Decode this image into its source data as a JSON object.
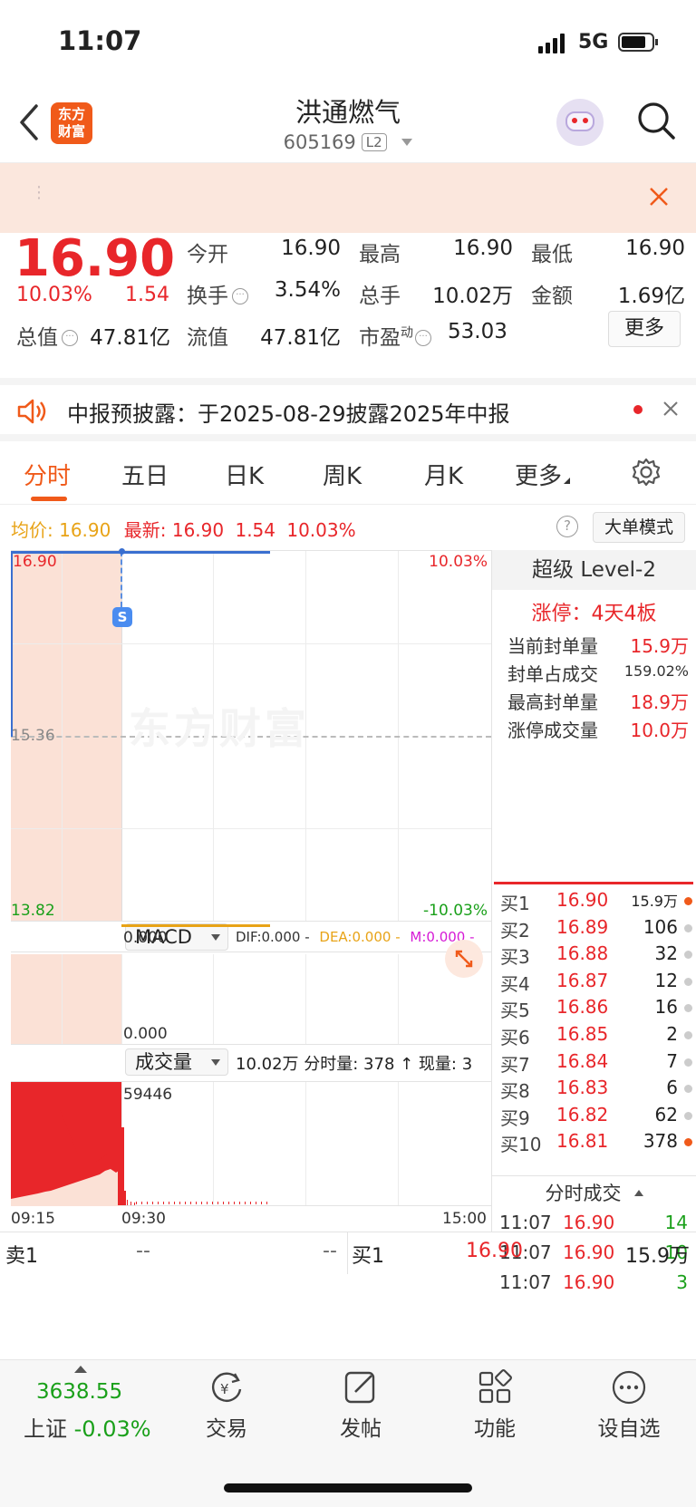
{
  "status_bar": {
    "time": "11:07",
    "network": "5G"
  },
  "header": {
    "stock_name": "洪通燃气",
    "stock_code": "605169",
    "level_badge": "L2",
    "logo_text": "东方财富"
  },
  "quote": {
    "price": "16.90",
    "change_pct": "10.03%",
    "change": "1.54",
    "open_label": "今开",
    "open": "16.90",
    "high_label": "最高",
    "high": "16.90",
    "low_label": "最低",
    "low": "16.90",
    "turnover_label": "换手",
    "turnover": "3.54%",
    "volume_label": "总手",
    "volume": "10.02万",
    "amount_label": "金额",
    "amount": "1.69亿",
    "market_cap_label": "总值",
    "market_cap": "47.81亿",
    "float_cap_label": "流值",
    "float_cap": "47.81亿",
    "pe_label": "市盈",
    "pe_super": "动",
    "pe": "53.03",
    "more_button": "更多"
  },
  "notice": {
    "text": "中报预披露：于2025-08-29披露2025年中报"
  },
  "tabs": [
    "分时",
    "五日",
    "日K",
    "周K",
    "月K",
    "更多"
  ],
  "chart_info": {
    "avg_label": "均价:",
    "avg_value": "16.90",
    "latest_label": "最新:",
    "latest_value": "16.90",
    "latest_change": "1.54",
    "latest_pct": "10.03%",
    "big_order_button": "大单模式"
  },
  "price_axis": {
    "top": "16.90",
    "mid": "15.36",
    "bottom": "13.82",
    "top_pct": "10.03%",
    "bottom_pct": "-10.03%"
  },
  "macd": {
    "selector": "MACD",
    "dif": "DIF:0.000 -",
    "dea": "DEA:0.000 -",
    "m": "M:0.000 -",
    "top_value": "0.000",
    "bottom_value": "0.000"
  },
  "volume_panel": {
    "selector": "成交量",
    "summary": "10.02万 分时量: 378 ↑ 现量: 3",
    "max_value": "59446",
    "time_start": "09:15",
    "time_mid": "09:30",
    "time_end": "15:00"
  },
  "level2": {
    "title": "超级 Level-2",
    "limit_status": "涨停：4天4板",
    "rows": [
      {
        "label": "当前封单量",
        "value": "15.9万"
      },
      {
        "label": "封单占成交",
        "value": "159.02%"
      },
      {
        "label": "最高封单量",
        "value": "18.9万"
      },
      {
        "label": "涨停成交量",
        "value": "10.0万"
      }
    ]
  },
  "order_book": [
    {
      "label": "买1",
      "price": "16.90",
      "volume": "15.9万",
      "dot": "#f05a1a"
    },
    {
      "label": "买2",
      "price": "16.89",
      "volume": "106",
      "dot": "#cccccc"
    },
    {
      "label": "买3",
      "price": "16.88",
      "volume": "32",
      "dot": "#cccccc"
    },
    {
      "label": "买4",
      "price": "16.87",
      "volume": "12",
      "dot": "#cccccc"
    },
    {
      "label": "买5",
      "price": "16.86",
      "volume": "16",
      "dot": "#cccccc"
    },
    {
      "label": "买6",
      "price": "16.85",
      "volume": "2",
      "dot": "#cccccc"
    },
    {
      "label": "买7",
      "price": "16.84",
      "volume": "7",
      "dot": "#cccccc"
    },
    {
      "label": "买8",
      "price": "16.83",
      "volume": "6",
      "dot": "#cccccc"
    },
    {
      "label": "买9",
      "price": "16.82",
      "volume": "62",
      "dot": "#cccccc"
    },
    {
      "label": "买10",
      "price": "16.81",
      "volume": "378",
      "dot": "#f05a1a"
    }
  ],
  "trades": {
    "title": "分时成交",
    "rows": [
      {
        "time": "11:07",
        "price": "16.90",
        "volume": "14"
      },
      {
        "time": "11:07",
        "price": "16.90",
        "volume": "10"
      },
      {
        "time": "11:07",
        "price": "16.90",
        "volume": "3"
      }
    ]
  },
  "level1": {
    "sell_label": "卖1",
    "sell_price": "--",
    "sell_volume": "--",
    "buy_label": "买1",
    "buy_price": "16.90",
    "buy_volume": "15.9万"
  },
  "bottom_bar": {
    "index_value": "3638.55",
    "index_name": "上证",
    "index_change": "-0.03%",
    "items": [
      "交易",
      "发帖",
      "功能",
      "设自选"
    ]
  },
  "colors": {
    "up": "#e8262a",
    "down": "#1aa01a",
    "accent": "#f05a1a",
    "avg": "#e8a317"
  }
}
